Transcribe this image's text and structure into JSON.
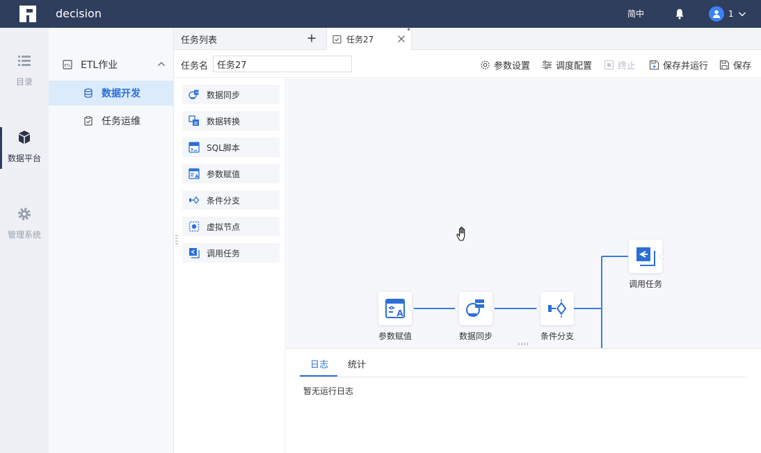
{
  "header": {
    "app_title": "decision",
    "lang_label": "简中",
    "user_name": "1"
  },
  "left_nav": [
    {
      "label": "目录",
      "icon": "list-icon"
    },
    {
      "label": "数据平台",
      "icon": "cubes-icon",
      "active": true
    },
    {
      "label": "管理系统",
      "icon": "gear-icon"
    }
  ],
  "sidebar": {
    "group_label": "ETL作业",
    "items": [
      {
        "label": "数据开发",
        "active": true
      },
      {
        "label": "任务运维"
      }
    ]
  },
  "tabs": {
    "list_label": "任务列表",
    "doc_label": "任务27",
    "modified_marker": "*"
  },
  "toolbar": {
    "task_name_label": "任务名",
    "task_name_value": "任务27",
    "param_settings": "参数设置",
    "schedule_config": "调度配置",
    "stop": "终止",
    "save_and_run": "保存并运行",
    "save": "保存"
  },
  "palette": [
    {
      "label": "数据同步",
      "icon": "data-sync-icon"
    },
    {
      "label": "数据转换",
      "icon": "data-transform-icon"
    },
    {
      "label": "SQL脚本",
      "icon": "sql-script-icon"
    },
    {
      "label": "参数赋值",
      "icon": "param-assign-icon"
    },
    {
      "label": "条件分支",
      "icon": "condition-branch-icon"
    },
    {
      "label": "虚拟节点",
      "icon": "virtual-node-icon"
    },
    {
      "label": "调用任务",
      "icon": "call-task-icon"
    }
  ],
  "canvas": {
    "nodes": [
      {
        "label": "参数赋值",
        "icon": "param-assign-icon"
      },
      {
        "label": "数据同步",
        "icon": "data-sync-icon"
      },
      {
        "label": "条件分支",
        "icon": "condition-branch-icon"
      },
      {
        "label": "调用任务",
        "icon": "call-task-icon"
      }
    ]
  },
  "log": {
    "tab_log": "日志",
    "tab_stats": "统计",
    "empty_text": "暂无运行日志"
  },
  "colors": {
    "topbar": "#2f3e5c",
    "accent": "#2b6fd6",
    "connector": "#3a7be0"
  }
}
